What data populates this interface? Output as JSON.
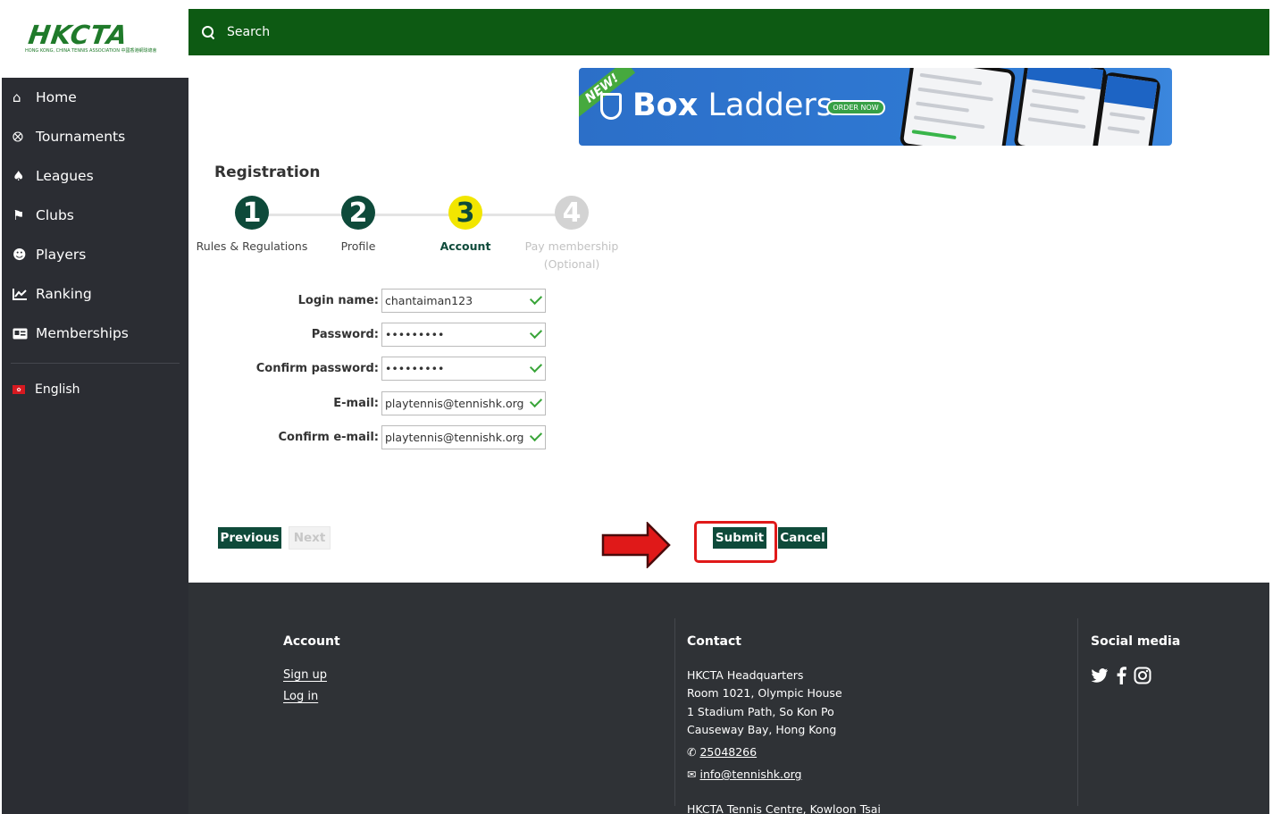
{
  "brand": {
    "logo_text": "HKCTA",
    "logo_sub": "HONG KONG, CHINA TENNIS ASSOCIATION 中國香港網球總會"
  },
  "search": {
    "label": "Search"
  },
  "nav": {
    "items": [
      {
        "label": "Home",
        "icon": "home-icon"
      },
      {
        "label": "Tournaments",
        "icon": "medal-icon"
      },
      {
        "label": "Leagues",
        "icon": "trophy-icon"
      },
      {
        "label": "Clubs",
        "icon": "flag-icon"
      },
      {
        "label": "Players",
        "icon": "users-icon"
      },
      {
        "label": "Ranking",
        "icon": "chart-icon"
      },
      {
        "label": "Memberships",
        "icon": "id-card-icon"
      }
    ],
    "language": "English"
  },
  "banner": {
    "ribbon": "NEW!",
    "title_bold": "Box",
    "title_rest": " Ladders",
    "cta": "ORDER NOW"
  },
  "registration": {
    "title": "Registration",
    "steps": [
      {
        "number": "1",
        "label": "Rules & Regulations",
        "state": "done"
      },
      {
        "number": "2",
        "label": "Profile",
        "state": "done"
      },
      {
        "number": "3",
        "label": "Account",
        "state": "active"
      },
      {
        "number": "4",
        "label": "Pay membership",
        "sublabel": "(Optional)",
        "state": "pending"
      }
    ],
    "fields": [
      {
        "label": "Login name:",
        "value": "chantaiman123"
      },
      {
        "label": "Password:",
        "value": "•••••••••"
      },
      {
        "label": "Confirm password:",
        "value": "•••••••••"
      },
      {
        "label": "E-mail:",
        "value": "playtennis@tennishk.org"
      },
      {
        "label": "Confirm e-mail:",
        "value": "playtennis@tennishk.org"
      }
    ],
    "buttons": {
      "previous": "Previous",
      "next": "Next",
      "submit": "Submit",
      "cancel": "Cancel"
    }
  },
  "footer": {
    "account": {
      "title": "Account",
      "links": [
        "Sign up",
        "Log in"
      ]
    },
    "contact": {
      "title": "Contact",
      "lines": [
        "HKCTA Headquarters",
        "Room 1021, Olympic House",
        "1 Stadium Path, So Kon Po",
        "Causeway Bay, Hong Kong"
      ],
      "phone": "25048266",
      "email": "info@tennishk.org",
      "extra": "HKCTA Tennis Centre, Kowloon Tsai"
    },
    "social": {
      "title": "Social media",
      "icons": [
        "twitter-icon",
        "facebook-icon",
        "instagram-icon"
      ]
    }
  },
  "colors": {
    "primary": "#0d5a13",
    "button": "#0e4a3a",
    "active_step": "#f2e600",
    "sidebar": "#2b2d33",
    "footer": "#2f3236",
    "highlight": "#e01919"
  }
}
